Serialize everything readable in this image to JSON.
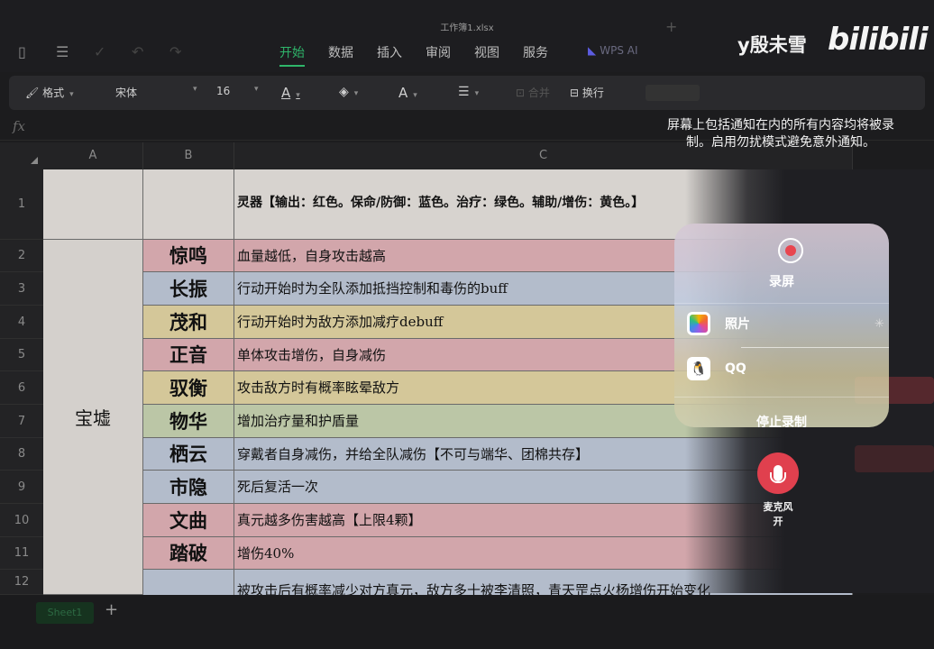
{
  "window": {
    "doc_title": "工作簿1.xlsx"
  },
  "menu": {
    "tabs": [
      "开始",
      "数据",
      "插入",
      "审阅",
      "视图",
      "服务"
    ],
    "active": 0,
    "wps_ai": "WPS AI"
  },
  "watermark": {
    "uploader": "y殷未雪",
    "brand": "bilibili"
  },
  "toolbar": {
    "format_label": "格式",
    "font_name": "宋体",
    "font_size": "16",
    "text_color_glyph": "A",
    "font_glyph": "A",
    "wrap_label": "换行",
    "dim_label": "合并"
  },
  "formula_bar": {
    "fx": "fx"
  },
  "sheet": {
    "columns": [
      "A",
      "B",
      "C"
    ],
    "row_numbers": [
      "1",
      "2",
      "3",
      "4",
      "5",
      "6",
      "7",
      "8",
      "9",
      "10",
      "11",
      "12"
    ],
    "c1_text": "灵器【输出：红色。保命/防御：蓝色。治疗：绿色。辅助/增伤：黄色。】",
    "merged_a_text": "宝墟",
    "rows": [
      {
        "name": "惊鸣",
        "desc": "血量越低，自身攻击越高",
        "color": "red"
      },
      {
        "name": "长振",
        "desc": "行动开始时为全队添加抵挡控制和毒伤的buff",
        "color": "blue"
      },
      {
        "name": "茂和",
        "desc": "行动开始时为敌方添加减疗debuff",
        "color": "yellow"
      },
      {
        "name": "正音",
        "desc": "单体攻击增伤，自身减伤",
        "color": "red"
      },
      {
        "name": "驭衡",
        "desc": "攻击敌方时有概率眩晕敌方",
        "color": "yellow"
      },
      {
        "name": "物华",
        "desc": "增加治疗量和护盾量",
        "color": "green"
      },
      {
        "name": "栖云",
        "desc": "穿戴者自身减伤，并给全队减伤【不可与端华、团棉共存】",
        "color": "blue"
      },
      {
        "name": "市隐",
        "desc": "死后复活一次",
        "color": "blue"
      },
      {
        "name": "文曲",
        "desc": "真元越多伤害越高【上限4颗】",
        "color": "red"
      },
      {
        "name": "踏破",
        "desc": "增伤40%",
        "color": "red"
      },
      {
        "name": "",
        "desc": "被攻击后有概率减少对方真元，敌方多十被李清照，青天罡点火杨增伤开始变化",
        "color": "blue"
      }
    ],
    "sheet_tab": "Sheet1"
  },
  "recording_overlay": {
    "notice": "屏幕上包括通知在内的所有内容均将被录制。启用勿扰模式避免意外通知。",
    "record_label": "录屏",
    "apps": [
      {
        "name": "照片",
        "icon": "photos-icon"
      },
      {
        "name": "QQ",
        "icon": "qq-penguin-icon"
      }
    ],
    "stop_label": "停止录制",
    "mic_label_line1": "麦克风",
    "mic_label_line2": "开"
  }
}
